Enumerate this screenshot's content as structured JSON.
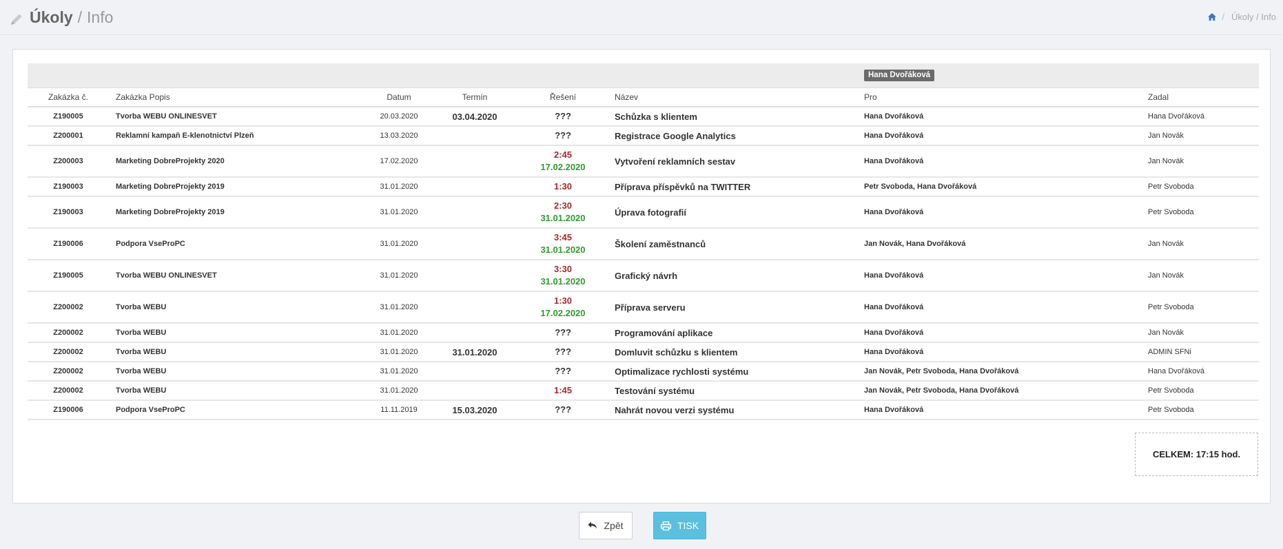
{
  "header": {
    "title": "Úkoly",
    "separator": "/",
    "subtitle": "Info",
    "breadcrumb": {
      "sep": "/",
      "current": "Úkoly / Info"
    }
  },
  "table": {
    "group_badge": "Hana Dvořáková",
    "columns": [
      "Zakázka č.",
      "Zakázka Popis",
      "Datum",
      "Termín",
      "Řešení",
      "Název",
      "Pro",
      "Zadal"
    ],
    "rows": [
      {
        "code": "Z190005",
        "popis": "Tvorba WEBU ONLINESVET",
        "datum": "20.03.2020",
        "termin": "03.04.2020",
        "res_time": "",
        "res_date": "",
        "res_q": "???",
        "nazev": "Schůzka s klientem",
        "pro": "Hana Dvořáková",
        "zadal": "Hana Dvořáková"
      },
      {
        "code": "Z200001",
        "popis": "Reklamní kampaň E-klenotnictví Plzeň",
        "datum": "13.03.2020",
        "termin": "",
        "res_time": "",
        "res_date": "",
        "res_q": "???",
        "nazev": "Registrace Google Analytics",
        "pro": "Hana Dvořáková",
        "zadal": "Jan Novák"
      },
      {
        "code": "Z200003",
        "popis": "Marketing DobreProjekty 2020",
        "datum": "17.02.2020",
        "termin": "",
        "res_time": "2:45",
        "res_date": "17.02.2020",
        "res_q": "",
        "nazev": "Vytvoření reklamních sestav",
        "pro": "Hana Dvořáková",
        "zadal": "Jan Novák"
      },
      {
        "code": "Z190003",
        "popis": "Marketing DobreProjekty 2019",
        "datum": "31.01.2020",
        "termin": "",
        "res_time": "1:30",
        "res_date": "",
        "res_q": "",
        "nazev": "Příprava příspěvků na TWITTER",
        "pro": "Petr Svoboda, Hana Dvořáková",
        "zadal": "Petr Svoboda"
      },
      {
        "code": "Z190003",
        "popis": "Marketing DobreProjekty 2019",
        "datum": "31.01.2020",
        "termin": "",
        "res_time": "2:30",
        "res_date": "31.01.2020",
        "res_q": "",
        "nazev": "Úprava fotografií",
        "pro": "Hana Dvořáková",
        "zadal": "Petr Svoboda"
      },
      {
        "code": "Z190006",
        "popis": "Podpora VseProPC",
        "datum": "31.01.2020",
        "termin": "",
        "res_time": "3:45",
        "res_date": "31.01.2020",
        "res_q": "",
        "nazev": "Školení zaměstnanců",
        "pro": "Jan Novák, Hana Dvořáková",
        "zadal": "Jan Novák"
      },
      {
        "code": "Z190005",
        "popis": "Tvorba WEBU ONLINESVET",
        "datum": "31.01.2020",
        "termin": "",
        "res_time": "3:30",
        "res_date": "31.01.2020",
        "res_q": "",
        "nazev": "Grafický návrh",
        "pro": "Hana Dvořáková",
        "zadal": "Jan Novák"
      },
      {
        "code": "Z200002",
        "popis": "Tvorba WEBU",
        "datum": "31.01.2020",
        "termin": "",
        "res_time": "1:30",
        "res_date": "17.02.2020",
        "res_q": "",
        "nazev": "Příprava serveru",
        "pro": "Hana Dvořáková",
        "zadal": "Petr Svoboda"
      },
      {
        "code": "Z200002",
        "popis": "Tvorba WEBU",
        "datum": "31.01.2020",
        "termin": "",
        "res_time": "",
        "res_date": "",
        "res_q": "???",
        "nazev": "Programování aplikace",
        "pro": "Hana Dvořáková",
        "zadal": "Jan Novák"
      },
      {
        "code": "Z200002",
        "popis": "Tvorba WEBU",
        "datum": "31.01.2020",
        "termin": "31.01.2020",
        "res_time": "",
        "res_date": "",
        "res_q": "???",
        "nazev": "Domluvit schůzku s klientem",
        "pro": "Hana Dvořáková",
        "zadal": "ADMIN SFNi"
      },
      {
        "code": "Z200002",
        "popis": "Tvorba WEBU",
        "datum": "31.01.2020",
        "termin": "",
        "res_time": "",
        "res_date": "",
        "res_q": "???",
        "nazev": "Optimalizace rychlosti systému",
        "pro": "Jan Novák, Petr Svoboda, Hana Dvořáková",
        "zadal": "Hana Dvořáková"
      },
      {
        "code": "Z200002",
        "popis": "Tvorba WEBU",
        "datum": "31.01.2020",
        "termin": "",
        "res_time": "1:45",
        "res_date": "",
        "res_q": "",
        "nazev": "Testování systému",
        "pro": "Jan Novák, Petr Svoboda, Hana Dvořáková",
        "zadal": "Petr Svoboda"
      },
      {
        "code": "Z190006",
        "popis": "Podpora VseProPC",
        "datum": "11.11.2019",
        "termin": "15.03.2020",
        "res_time": "",
        "res_date": "",
        "res_q": "???",
        "nazev": "Nahrát novou verzi systému",
        "pro": "Hana Dvořáková",
        "zadal": "Petr Svoboda"
      }
    ]
  },
  "total": "CELKEM: 17:15 hod.",
  "buttons": {
    "back": "Zpět",
    "print": "TISK"
  },
  "colors": {
    "time": "#a52a2a",
    "date": "#2e9a2e",
    "print_button": "#5bc0de"
  },
  "icons": {
    "title": "pencil-icon",
    "breadcrumb": "home-icon",
    "back": "reply-arrow-icon",
    "print": "printer-icon"
  }
}
